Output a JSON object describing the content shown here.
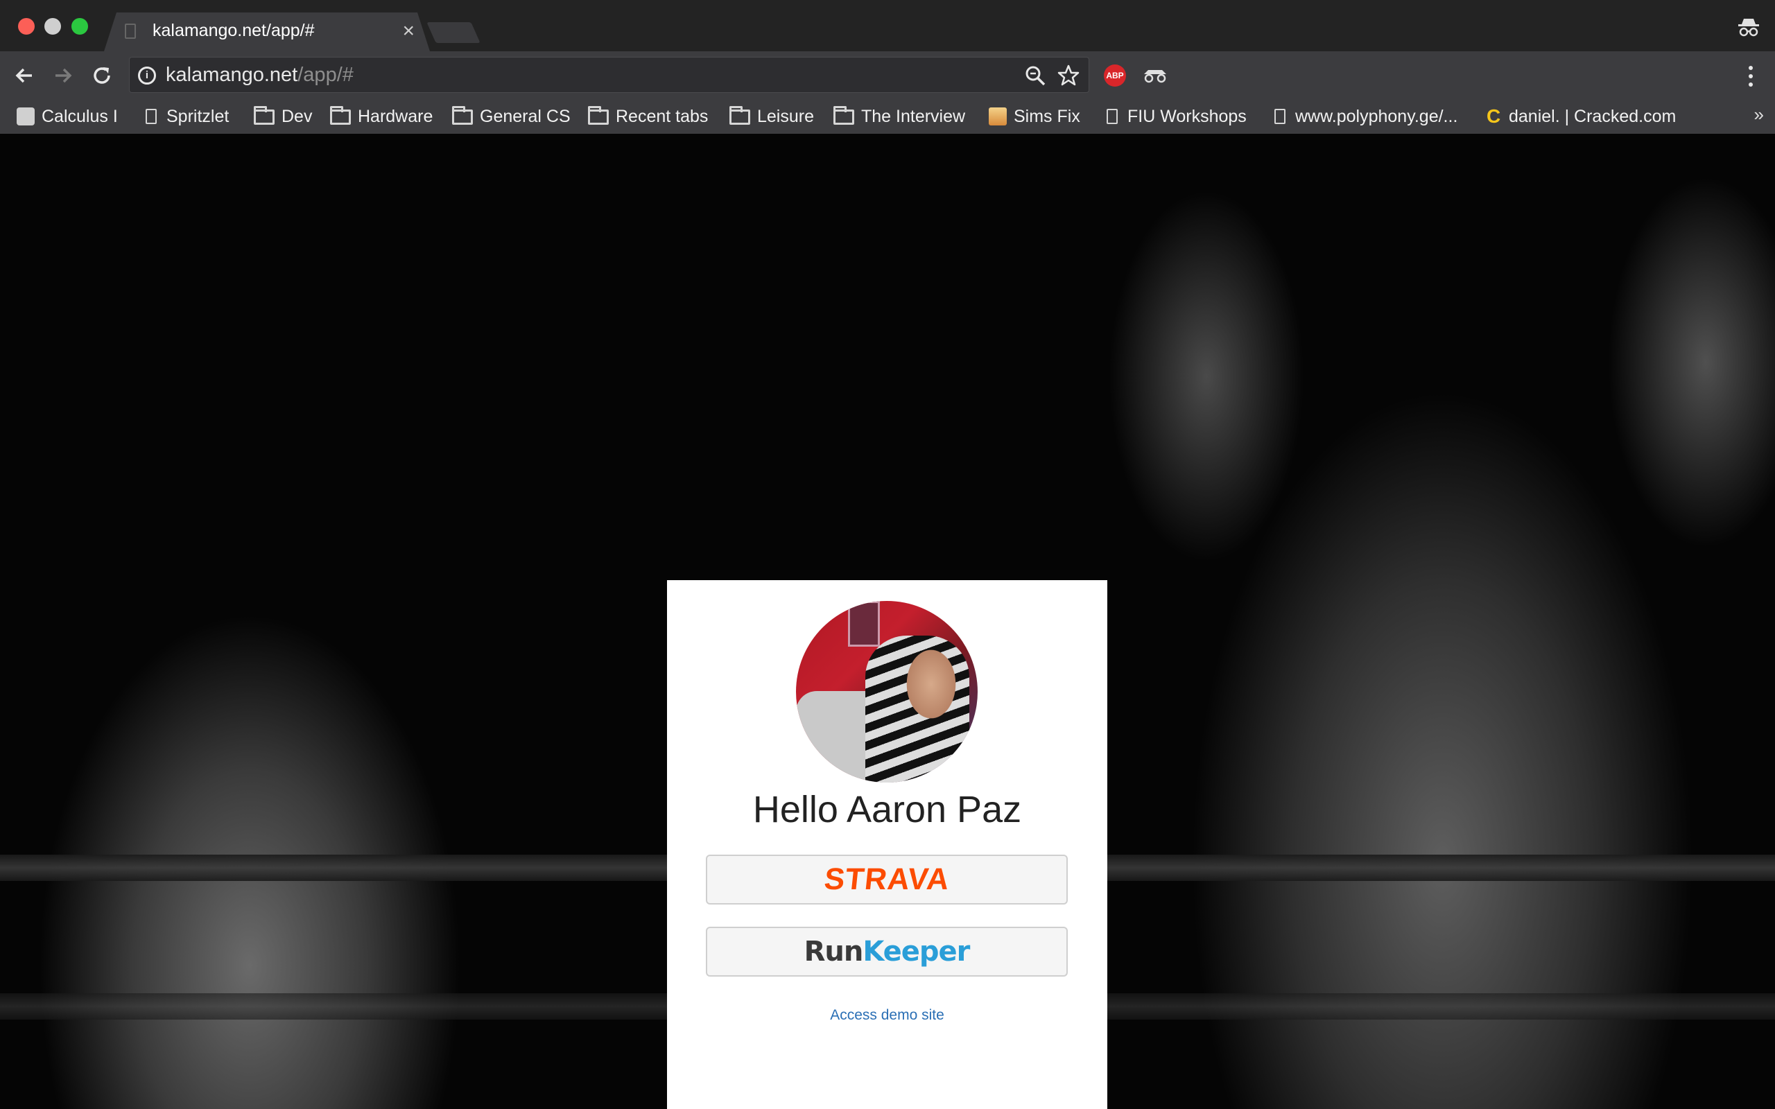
{
  "browser": {
    "tab_title": "kalamango.net/app/#",
    "url_host": "kalamango.net",
    "url_rest": "/app/#",
    "extensions": {
      "abp_label": "ABP"
    },
    "bookmarks": [
      {
        "label": "Calculus I",
        "icon": "apple-icon"
      },
      {
        "label": "Spritzlet",
        "icon": "page-icon"
      },
      {
        "label": "Dev",
        "icon": "folder-icon"
      },
      {
        "label": "Hardware",
        "icon": "folder-icon"
      },
      {
        "label": "General CS",
        "icon": "folder-icon"
      },
      {
        "label": "Recent tabs",
        "icon": "folder-icon"
      },
      {
        "label": "Leisure",
        "icon": "folder-icon"
      },
      {
        "label": "The Interview",
        "icon": "folder-icon"
      },
      {
        "label": "Sims Fix",
        "icon": "sims-icon"
      },
      {
        "label": "FIU Workshops",
        "icon": "page-icon"
      },
      {
        "label": "www.polyphony.ge/...",
        "icon": "page-icon"
      },
      {
        "label": "daniel. | Cracked.com",
        "icon": "cracked-icon"
      }
    ],
    "more_label": "»"
  },
  "page": {
    "greeting": "Hello Aaron Paz",
    "strava_label": "STRAVA",
    "runkeeper_run": "Run",
    "runkeeper_keeper": "Keeper",
    "demo_link": "Access demo site"
  },
  "colors": {
    "strava": "#fc4c02",
    "runkeeper": "#2a9ed8",
    "link": "#2a6fb5"
  }
}
